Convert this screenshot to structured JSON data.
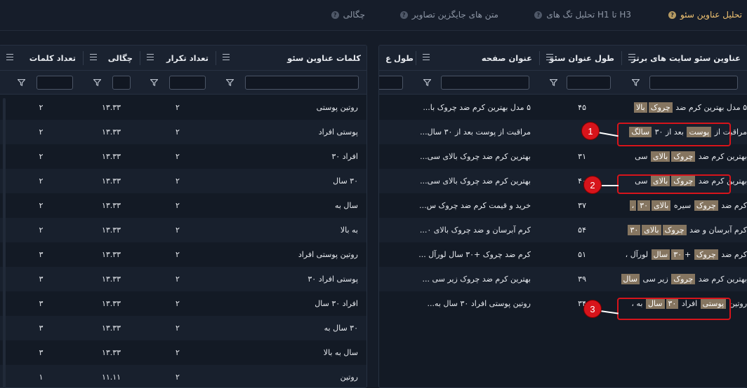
{
  "tabs": [
    {
      "label": "تحلیل عناوین سئو",
      "active": true
    },
    {
      "label": "تحلیل تگ های H1 تا H3",
      "active": false
    },
    {
      "label": "متن های جایگزین تصاویر",
      "active": false
    },
    {
      "label": "چگالی",
      "active": false
    }
  ],
  "right_table": {
    "headers": [
      "عناوین سئو سایت های برتر",
      "طول عنوان سئو",
      "عنوان صفحه",
      "طول ع"
    ],
    "rows": [
      {
        "segments": [
          {
            "t": "۵ مدل بهترین کرم ضد "
          },
          {
            "t": "چروک",
            "h": true
          },
          {
            "t": "بالا",
            "h": true
          }
        ],
        "len": "۴۵",
        "page": "۵ مدل بهترین کرم ضد چروک با..."
      },
      {
        "segments": [
          {
            "t": "مراقبت از "
          },
          {
            "t": "پوست",
            "h": true
          },
          {
            "t": " بعد از ۳۰ "
          },
          {
            "t": "سالگ",
            "h": true
          }
        ],
        "len": "۵",
        "page": "مراقبت از پوست بعد از ۳۰ سال..."
      },
      {
        "segments": [
          {
            "t": "بهترین کرم ضد "
          },
          {
            "t": "چروک",
            "h": true
          },
          {
            "t": "بالای",
            "h": true
          },
          {
            "t": " سی"
          }
        ],
        "len": "۳۱",
        "page": "بهترین کرم ضد چروک بالای سی..."
      },
      {
        "segments": [
          {
            "t": "بهترین کرم ضد "
          },
          {
            "t": "چروک",
            "h": true
          },
          {
            "t": "بالای",
            "h": true
          },
          {
            "t": " سی"
          }
        ],
        "len": "۴۰",
        "page": "بهترین کرم ضد چروک بالای سی..."
      },
      {
        "segments": [
          {
            "t": "کرم ضد "
          },
          {
            "t": "چروک",
            "h": true
          },
          {
            "t": " سیره "
          },
          {
            "t": "بالای",
            "h": true
          },
          {
            "t": "۳۰",
            "h": true
          },
          {
            "t": "،",
            "h": true
          }
        ],
        "len": "۳۷",
        "page": "خرید و قیمت کرم ضد چروک س..."
      },
      {
        "segments": [
          {
            "t": "کرم آبرسان و ضد "
          },
          {
            "t": "چروک",
            "h": true
          },
          {
            "t": "بالای",
            "h": true
          },
          {
            "t": "۳۰",
            "h": true
          }
        ],
        "len": "۵۴",
        "page": "کرم آبرسان و ضد چروک بالای ۰..."
      },
      {
        "segments": [
          {
            "t": "کرم ضد "
          },
          {
            "t": "چروک",
            "h": true
          },
          {
            "t": " +"
          },
          {
            "t": "۳۰",
            "h": true
          },
          {
            "t": "سال",
            "h": true
          },
          {
            "t": " لورآل ،"
          }
        ],
        "len": "۵۱",
        "page": "کرم ضد چروک +۳۰ سال لورآل ..."
      },
      {
        "segments": [
          {
            "t": "بهترین کرم ضد "
          },
          {
            "t": "چروک",
            "h": true
          },
          {
            "t": " زیر سی "
          },
          {
            "t": "سال",
            "h": true
          }
        ],
        "len": "۳۹",
        "page": "بهترین کرم ضد چروک زیر سی ..."
      },
      {
        "segments": [
          {
            "t": "روتین "
          },
          {
            "t": "پوستی",
            "h": true
          },
          {
            "t": " افراد "
          },
          {
            "t": "۳۰",
            "h": true
          },
          {
            "t": "سال",
            "h": true
          },
          {
            "t": " به ،"
          }
        ],
        "len": "۳۴",
        "page": "روتین پوستی  افراد ۳۰ سال به..."
      }
    ]
  },
  "left_table": {
    "headers": [
      "کلمات عناوین سئو",
      "تعداد تکرار",
      "چگالی",
      "تعداد کلمات"
    ],
    "rows": [
      {
        "kw": "روتین پوستی",
        "rep": "۲",
        "dens": "۱۳.۳۳",
        "words": "۲"
      },
      {
        "kw": "پوستی افراد",
        "rep": "۲",
        "dens": "۱۳.۳۳",
        "words": "۲"
      },
      {
        "kw": "افراد ۳۰",
        "rep": "۲",
        "dens": "۱۳.۳۳",
        "words": "۲"
      },
      {
        "kw": "۳۰ سال",
        "rep": "۲",
        "dens": "۱۳.۳۳",
        "words": "۲"
      },
      {
        "kw": "سال به",
        "rep": "۲",
        "dens": "۱۳.۳۳",
        "words": "۲"
      },
      {
        "kw": "به بالا",
        "rep": "۲",
        "dens": "۱۳.۳۳",
        "words": "۲"
      },
      {
        "kw": "روتین پوستی افراد",
        "rep": "۲",
        "dens": "۱۳.۳۳",
        "words": "۳"
      },
      {
        "kw": "پوستی افراد ۳۰",
        "rep": "۲",
        "dens": "۱۳.۳۳",
        "words": "۳"
      },
      {
        "kw": "افراد ۳۰ سال",
        "rep": "۲",
        "dens": "۱۳.۳۳",
        "words": "۳"
      },
      {
        "kw": "۳۰ سال به",
        "rep": "۲",
        "dens": "۱۳.۳۳",
        "words": "۳"
      },
      {
        "kw": "سال به بالا",
        "rep": "۲",
        "dens": "۱۳.۳۳",
        "words": "۳"
      },
      {
        "kw": "روتین",
        "rep": "۲",
        "dens": "۱۱.۱۱",
        "words": "۱"
      }
    ]
  },
  "annotations": [
    "1",
    "2",
    "3"
  ],
  "colors": {
    "accent": "#f0c271",
    "annotation": "#d7141b",
    "highlight": "#857560"
  }
}
